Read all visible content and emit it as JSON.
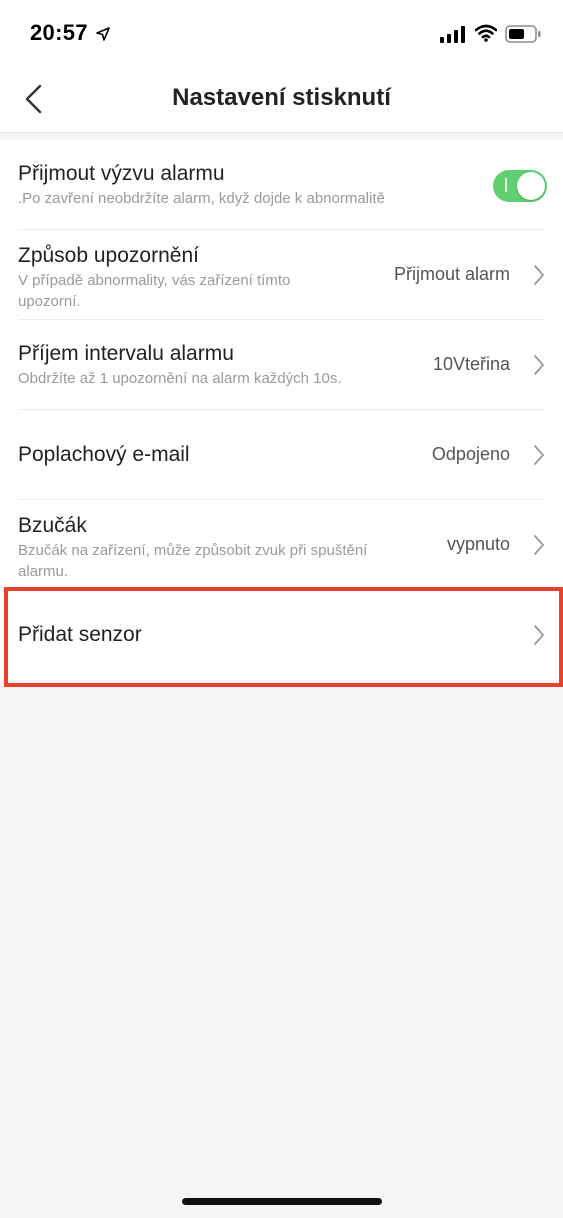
{
  "status_bar": {
    "time": "20:57"
  },
  "header": {
    "title": "Nastavení stisknutí"
  },
  "settings": [
    {
      "title": "Přijmout výzvu alarmu",
      "subtitle": ".Po zavření neobdržíte alarm, když dojde k abnormalitě",
      "toggle_on": true
    },
    {
      "title": "Způsob upozornění",
      "subtitle": "V případě abnormality, vás zařízení tímto upozorní.",
      "value": "Přijmout alarm"
    },
    {
      "title": "Příjem intervalu alarmu",
      "subtitle": "Obdržíte až 1 upozornění na alarm každých 10s.",
      "value": "10Vteřina"
    },
    {
      "title": "Poplachový e-mail",
      "value": "Odpojeno"
    },
    {
      "title": "Bzučák",
      "subtitle": "Bzučák na zařízení, může způsobit zvuk při spuštění alarmu.",
      "value": "vypnuto"
    },
    {
      "title": "Přidat senzor"
    }
  ],
  "colors": {
    "toggle_on": "#5fcf71",
    "highlight": "#e8412b"
  },
  "icons": {
    "back": "chevron-left-icon",
    "row_arrow": "chevron-right-icon"
  }
}
